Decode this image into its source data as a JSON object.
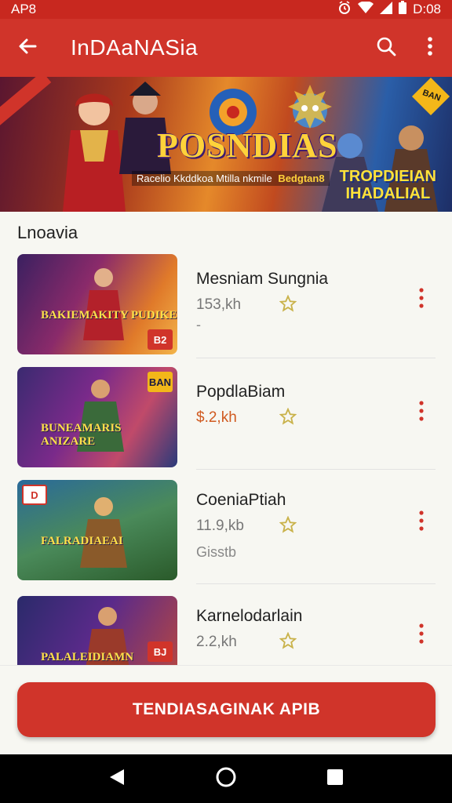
{
  "status_bar": {
    "left_label": "AP8",
    "time": "D:08"
  },
  "app_bar": {
    "title": "InDAaNASia"
  },
  "banner": {
    "title": "POSNDIAS",
    "subtitle": "Racelio Kkddkoa Mtilla nkmile",
    "highlight": "Bedgtan8",
    "right_text_line1": "TROPDIEIAN",
    "right_text_line2": "IHADALIAL",
    "corner_badge": "BAN"
  },
  "section": {
    "title": "Lnoavia"
  },
  "items": [
    {
      "name": "Mesniam Sungnia",
      "size": "153,kh",
      "extra": "-",
      "thumb_caption": "BAKIEMAKITY PUDIKE",
      "badge": "B2",
      "size_highlight": false
    },
    {
      "name": "PopdlaBiam",
      "size": "$.2,kh",
      "extra": "",
      "thumb_caption": "BUNEAMARIS ANIZARE",
      "badge": "BAN",
      "size_highlight": true
    },
    {
      "name": "CoeniaPtiah",
      "size": "11.9,kb",
      "extra": "Gisstb",
      "thumb_caption": "FALRADIAEAI",
      "badge": "D",
      "size_highlight": false
    },
    {
      "name": "Karnelodarlain",
      "size": "2.2,kh",
      "extra": "",
      "thumb_caption": "PALALEIDIAMN",
      "badge": "BJ",
      "size_highlight": false
    }
  ],
  "cta": {
    "label": "TENDIASAGINAK APIB"
  },
  "colors": {
    "primary": "#d0342a",
    "status": "#c8281f",
    "star": "#c9b24a"
  }
}
